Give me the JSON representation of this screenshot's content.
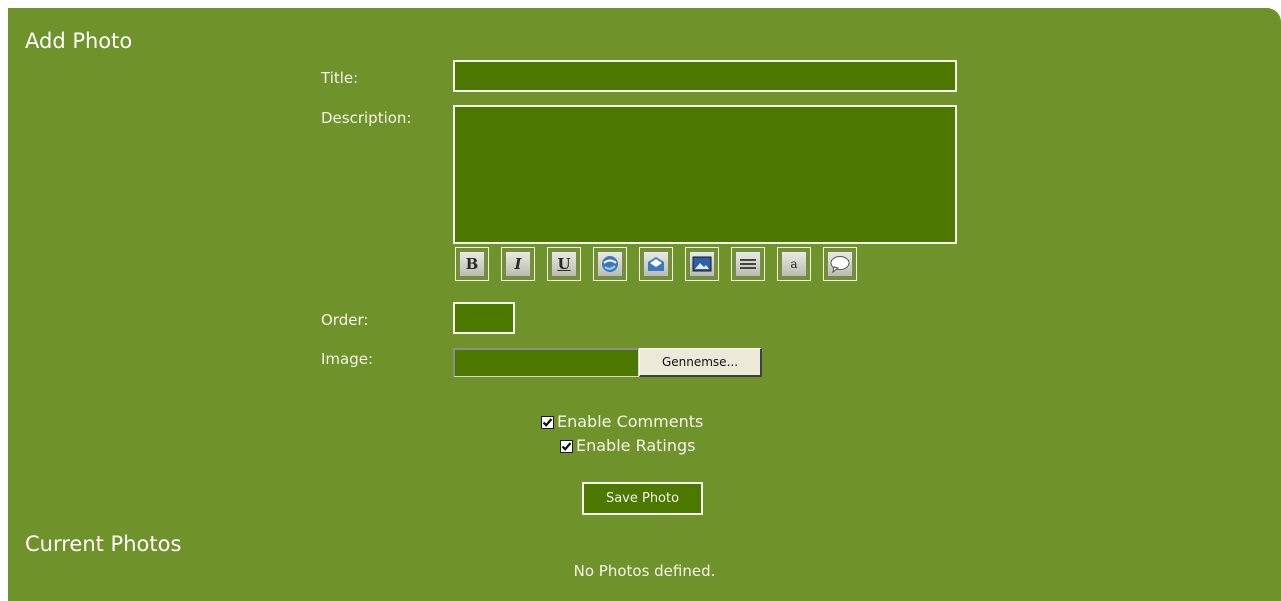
{
  "add_photo": {
    "heading": "Add Photo",
    "title_label": "Title:",
    "title_value": "",
    "description_label": "Description:",
    "description_value": "",
    "toolbar": [
      {
        "icon": "bold-icon",
        "label": "B"
      },
      {
        "icon": "italic-icon",
        "label": "I"
      },
      {
        "icon": "underline-icon",
        "label": "U"
      },
      {
        "icon": "link-icon",
        "label": ""
      },
      {
        "icon": "email-icon",
        "label": ""
      },
      {
        "icon": "image-icon",
        "label": ""
      },
      {
        "icon": "align-icon",
        "label": ""
      },
      {
        "icon": "font-icon",
        "label": "a"
      },
      {
        "icon": "quote-icon",
        "label": ""
      }
    ],
    "order_label": "Order:",
    "order_value": "",
    "image_label": "Image:",
    "browse_label": "Gennemse...",
    "enable_comments_label": "Enable Comments",
    "enable_comments_checked": true,
    "enable_ratings_label": "Enable Ratings",
    "enable_ratings_checked": true,
    "save_label": "Save Photo"
  },
  "current_photos": {
    "heading": "Current Photos",
    "empty_message": "No Photos defined."
  },
  "colors": {
    "panel": "#6f922a",
    "field": "#4d7800",
    "text": "#f3f6ea"
  }
}
